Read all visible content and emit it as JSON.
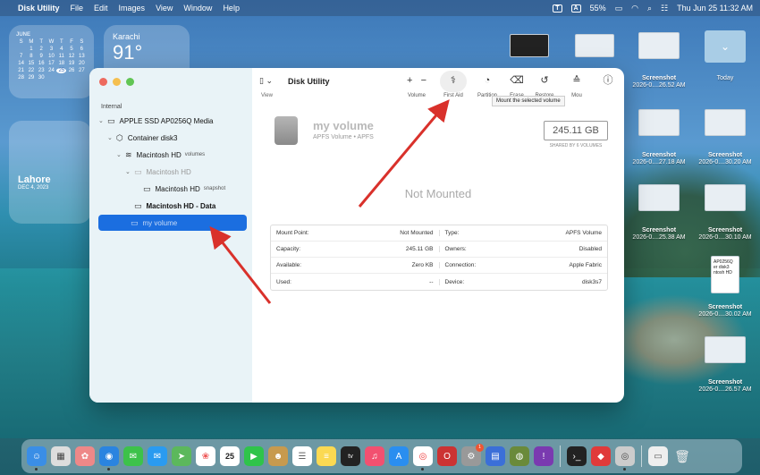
{
  "menubar": {
    "app_name": "Disk Utility",
    "items": [
      "File",
      "Edit",
      "Images",
      "View",
      "Window",
      "Help"
    ],
    "battery": "55%",
    "datetime": "Thu Jun 25  11:32 AM",
    "t_badge": "T",
    "a_badge": "A"
  },
  "widgets": {
    "calendar": {
      "month": "JUNE",
      "weekdays": [
        "S",
        "M",
        "T",
        "W",
        "T",
        "F",
        "S"
      ],
      "weeks": [
        [
          "",
          "1",
          "2",
          "3",
          "4",
          "5",
          "6"
        ],
        [
          "7",
          "8",
          "9",
          "10",
          "11",
          "12",
          "13"
        ],
        [
          "14",
          "15",
          "16",
          "17",
          "18",
          "19",
          "20"
        ],
        [
          "21",
          "22",
          "23",
          "24",
          "25",
          "26",
          "27"
        ],
        [
          "28",
          "29",
          "30",
          "",
          "",
          "",
          ""
        ]
      ],
      "today": "25"
    },
    "weather": {
      "city": "Karachi",
      "temp": "91°"
    },
    "lahore": {
      "city": "Lahore",
      "date": "DEC 4, 2023"
    }
  },
  "sidebar": {
    "section": "Internal",
    "items": [
      {
        "label": "APPLE SSD AP0256Q Media",
        "sub": ""
      },
      {
        "label": "Container disk3",
        "sub": ""
      },
      {
        "label": "Macintosh HD",
        "sub": "volumes"
      },
      {
        "label": "Macintosh HD",
        "sub": ""
      },
      {
        "label": "Macintosh HD",
        "sub": "snapshot"
      },
      {
        "label": "Macintosh HD - Data",
        "sub": ""
      },
      {
        "label": "my volume",
        "sub": ""
      }
    ]
  },
  "toolbar": {
    "view_label": "View",
    "title": "Disk Utility",
    "volume_label": "Volume",
    "first_aid_label": "First Aid",
    "partition_label": "Partition",
    "erase_label": "Erase",
    "restore_label": "Restore",
    "mount_label": "Mou",
    "tooltip": "Mount the selected volume"
  },
  "volume": {
    "name": "my volume",
    "type": "APFS Volume • APFS",
    "size": "245.11 GB",
    "shared": "SHARED BY 6 VOLUMES",
    "status": "Not Mounted"
  },
  "info": [
    {
      "k1": "Mount Point:",
      "v1": "Not Mounted",
      "k2": "Type:",
      "v2": "APFS Volume"
    },
    {
      "k1": "Capacity:",
      "v1": "245.11 GB",
      "k2": "Owners:",
      "v2": "Disabled"
    },
    {
      "k1": "Available:",
      "v1": "Zero KB",
      "k2": "Connection:",
      "v2": "Apple Fabric"
    },
    {
      "k1": "Used:",
      "v1": "--",
      "k2": "Device:",
      "v2": "disk3s7"
    }
  ],
  "desktop": {
    "today_folder": "Today",
    "screenshots": [
      {
        "name": "Screenshot",
        "time": "2026-0....26.52 AM"
      },
      {
        "name": "Screenshot",
        "time": "2026-0....27.18 AM"
      },
      {
        "name": "Screenshot",
        "time": "2026-0....30.20 AM"
      },
      {
        "name": "Screenshot",
        "time": "2026-0....25.38 AM"
      },
      {
        "name": "Screenshot",
        "time": "2026-0....30.10 AM"
      },
      {
        "name": "Screenshot",
        "time": "2026-0....30.02 AM"
      },
      {
        "name": "Screenshot",
        "time": "2026-0....26.57 AM"
      }
    ],
    "file_lines": [
      "AP0256Q",
      "er disk3",
      "ntosh HD"
    ]
  },
  "dock": {
    "calendar_day": "25",
    "badge_count": "1",
    "tv_label": "tv"
  },
  "colors": {
    "accent": "#1b6ee0",
    "arrow": "#d9312b"
  }
}
